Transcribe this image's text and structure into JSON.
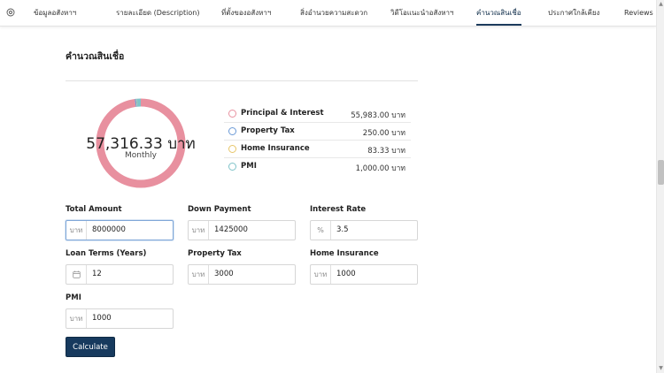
{
  "nav": {
    "items": [
      {
        "label": "ข้อมูลอสังหาฯ",
        "active": false
      },
      {
        "label": "รายละเอียด (Description)",
        "active": false
      },
      {
        "label": "ที่ตั้งของอสังหาฯ",
        "active": false
      },
      {
        "label": "สิ่งอำนวยความสะดวก",
        "active": false
      },
      {
        "label": "วิดีโอแนะนำอสังหาฯ",
        "active": false
      },
      {
        "label": "คำนวณสินเชื่อ",
        "active": true
      },
      {
        "label": "ประกาศใกล้เคียง",
        "active": false
      },
      {
        "label": "Reviews",
        "active": false
      }
    ],
    "home_icon": "home-icon"
  },
  "section": {
    "title": "คำนวณสินเชื่อ"
  },
  "summary": {
    "monthly_amount": "57,316.33 บาท",
    "monthly_label": "Monthly"
  },
  "breakdown": [
    {
      "label": "Principal & Interest",
      "value": "55,983.00 บาท",
      "color": "#e8909f",
      "share": 0.9767
    },
    {
      "label": "Property Tax",
      "value": "250.00 บาท",
      "color": "#6b9ad6",
      "share": 0.0044
    },
    {
      "label": "Home Insurance",
      "value": "83.33 บาท",
      "color": "#e7c66a",
      "share": 0.0015
    },
    {
      "label": "PMI",
      "value": "1,000.00 บาท",
      "color": "#7fc3c9",
      "share": 0.0174
    }
  ],
  "form": {
    "total_amount": {
      "label": "Total Amount",
      "prefix": "บาท",
      "value": "8000000"
    },
    "down_payment": {
      "label": "Down Payment",
      "prefix": "บาท",
      "value": "1425000"
    },
    "interest_rate": {
      "label": "Interest Rate",
      "prefix": "%",
      "value": "3.5"
    },
    "loan_terms": {
      "label": "Loan Terms (Years)",
      "prefix_icon": "calendar-icon",
      "value": "12"
    },
    "property_tax": {
      "label": "Property Tax",
      "prefix": "บาท",
      "value": "3000"
    },
    "home_insurance": {
      "label": "Home Insurance",
      "prefix": "บาท",
      "value": "1000"
    },
    "pmi": {
      "label": "PMI",
      "prefix": "บาท",
      "value": "1000"
    }
  },
  "calculate_label": "Calculate"
}
